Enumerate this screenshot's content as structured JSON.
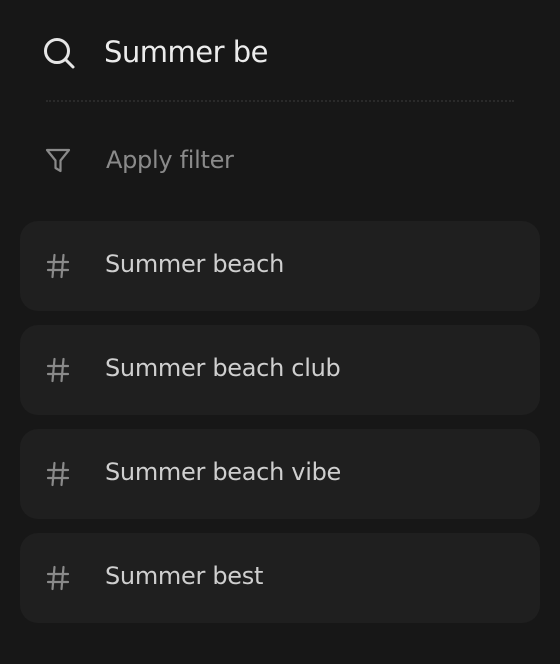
{
  "search": {
    "value": "Summer be",
    "icon": "search-icon"
  },
  "filter": {
    "label": "Apply filter",
    "icon": "filter-icon"
  },
  "suggestions": [
    {
      "label": "Summer beach",
      "icon": "hash-icon"
    },
    {
      "label": "Summer beach club",
      "icon": "hash-icon"
    },
    {
      "label": "Summer beach vibe",
      "icon": "hash-icon"
    },
    {
      "label": "Summer best",
      "icon": "hash-icon"
    }
  ],
  "colors": {
    "background": "#171717",
    "card": "#1f1f1f",
    "text_primary": "#ececec",
    "text_secondary": "#8a8a8a"
  }
}
